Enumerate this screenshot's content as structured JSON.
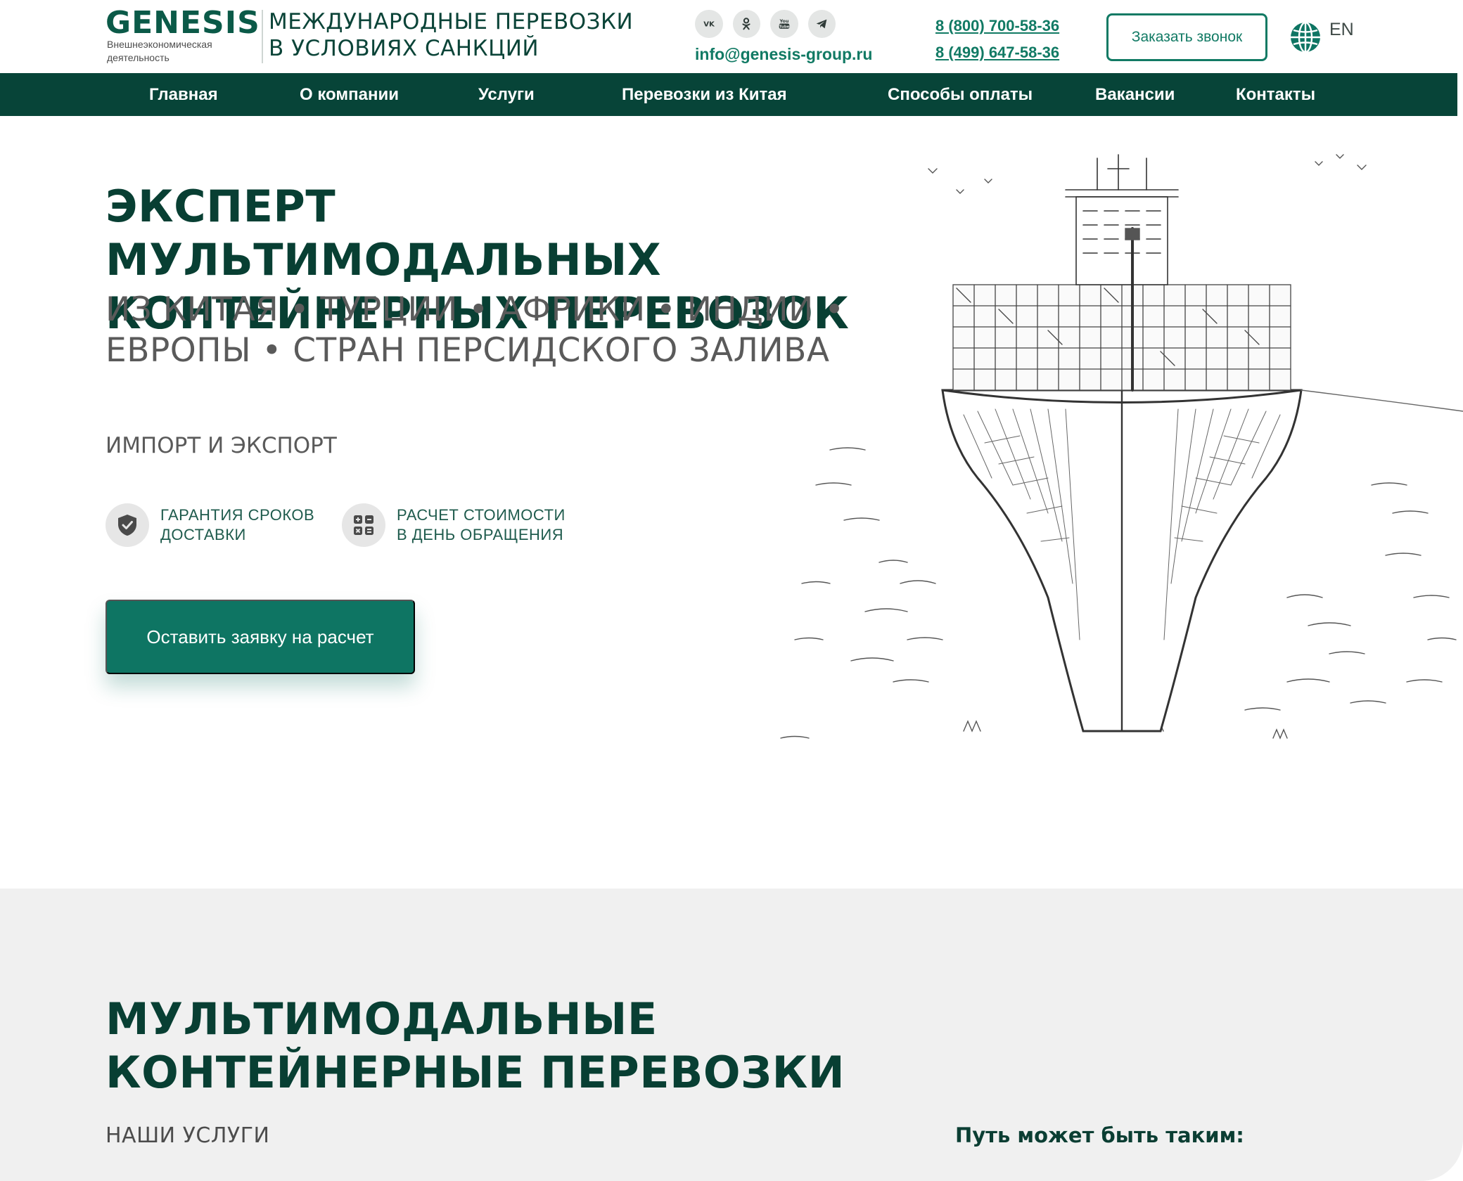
{
  "header": {
    "logo_word": "GENESIS",
    "logo_sub": "Внешнеэкономическая деятельность",
    "tagline_line1": "МЕЖДУНАРОДНЫЕ ПЕРЕВОЗКИ",
    "tagline_line2": "В УСЛОВИЯХ САНКЦИЙ",
    "socials": [
      {
        "label": "VK",
        "icon": "vk-icon"
      },
      {
        "label": "OK",
        "icon": "odnoklassniki-icon"
      },
      {
        "label": "YouTube",
        "icon": "youtube-icon"
      },
      {
        "label": "Telegram",
        "icon": "telegram-icon"
      }
    ],
    "email": "info@genesis-group.ru",
    "phone1": "8 (800) 700-58-36",
    "phone2": "8 (499) 647-58-36",
    "callback_label": "Заказать звонок",
    "lang_label": "EN",
    "lang_icon": "globe-icon"
  },
  "nav": {
    "items": [
      "Главная",
      "О компании",
      "Услуги",
      "Перевозки из Китая",
      "Способы оплаты",
      "Вакансии",
      "Контакты"
    ]
  },
  "hero": {
    "title_line1": "ЭКСПЕРТ МУЛЬТИМОДАЛЬНЫХ",
    "title_line2": "КОНТЕЙНЕРНЫХ ПЕРЕВОЗОК",
    "sub_line1": "ИЗ КИТАЯ • ТУРЦИИ • АФРИКИ • ИНДИИ •",
    "sub_line2": "ЕВРОПЫ • СТРАН ПЕРСИДСКОГО ЗАЛИВА",
    "import_export": "ИМПОРТ И ЭКСПОРТ",
    "features": [
      {
        "line1": "ГАРАНТИЯ СРОКОВ",
        "line2": "ДОСТАВКИ",
        "icon": "shield-icon"
      },
      {
        "line1": "РАСЧЕТ СТОИМОСТИ",
        "line2": "В ДЕНЬ ОБРАЩЕНИЯ",
        "icon": "calculator-icon"
      }
    ],
    "cta_label": "Оставить заявку на расчет",
    "image_icon": "container-ship-illustration"
  },
  "section2": {
    "title_line1": "МУЛЬТИМОДАЛЬНЫЕ",
    "title_line2": "КОНТЕЙНЕРНЫЕ ПЕРЕВОЗКИ",
    "services_label": "НАШИ УСЛУГИ",
    "path_label": "Путь может быть таким:"
  },
  "colors": {
    "brand": "#0b5a48",
    "nav_bg": "#074438",
    "accent": "#117a64",
    "button_bg": "#0e7563",
    "section_bg": "#f0f0f0"
  }
}
